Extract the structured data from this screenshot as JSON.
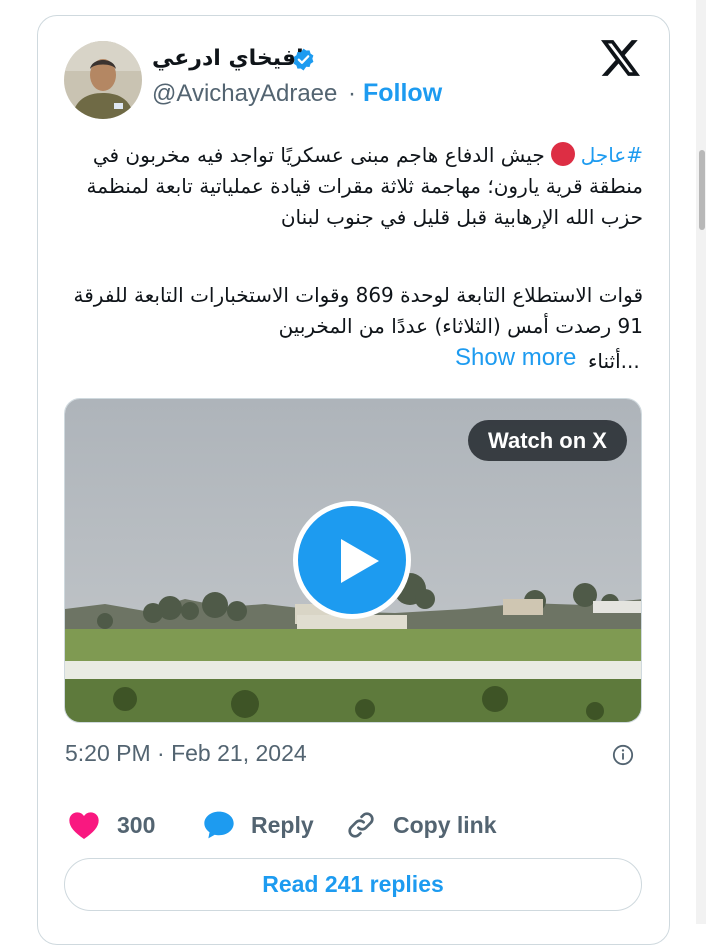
{
  "tweet": {
    "display_name": "افيخاي ادرعي",
    "handle": "@AvichayAdraee",
    "dot": "·",
    "follow_label": "Follow",
    "hashtag": "#عاجل",
    "line1_rest": "جيش الدفاع هاجم مبنى عسكريًا تواجد فيه مخربون في منطقة قرية يارون؛ مهاجمة ثلاثة مقرات قيادة عملياتية تابعة لمنظمة حزب الله الإرهابية قبل قليل في جنوب لبنان",
    "paragraph2": "قوات الاستطلاع التابعة لوحدة 869 وقوات الاستخبارات التابعة للفرقة 91 رصدت أمس (الثلاثاء) عددًا من المخربين",
    "paragraph2_end": "أثناء...",
    "show_more_label": "Show more",
    "watch_label": "Watch on X",
    "timestamp": "5:20 PM · Feb 21, 2024",
    "likes": "300",
    "reply_label": "Reply",
    "copy_link_label": "Copy link",
    "read_replies_label": "Read 241 replies"
  },
  "icons": {
    "x_logo": "x-logo-icon",
    "verified": "verified-badge-icon",
    "heart": "heart-icon",
    "reply": "speech-bubble-icon",
    "link": "link-icon",
    "info": "info-icon",
    "play": "play-icon"
  },
  "colors": {
    "accent": "#1d9bf0",
    "heart": "#f91880",
    "muted": "#536471",
    "red_circle": "#dd2e44"
  }
}
